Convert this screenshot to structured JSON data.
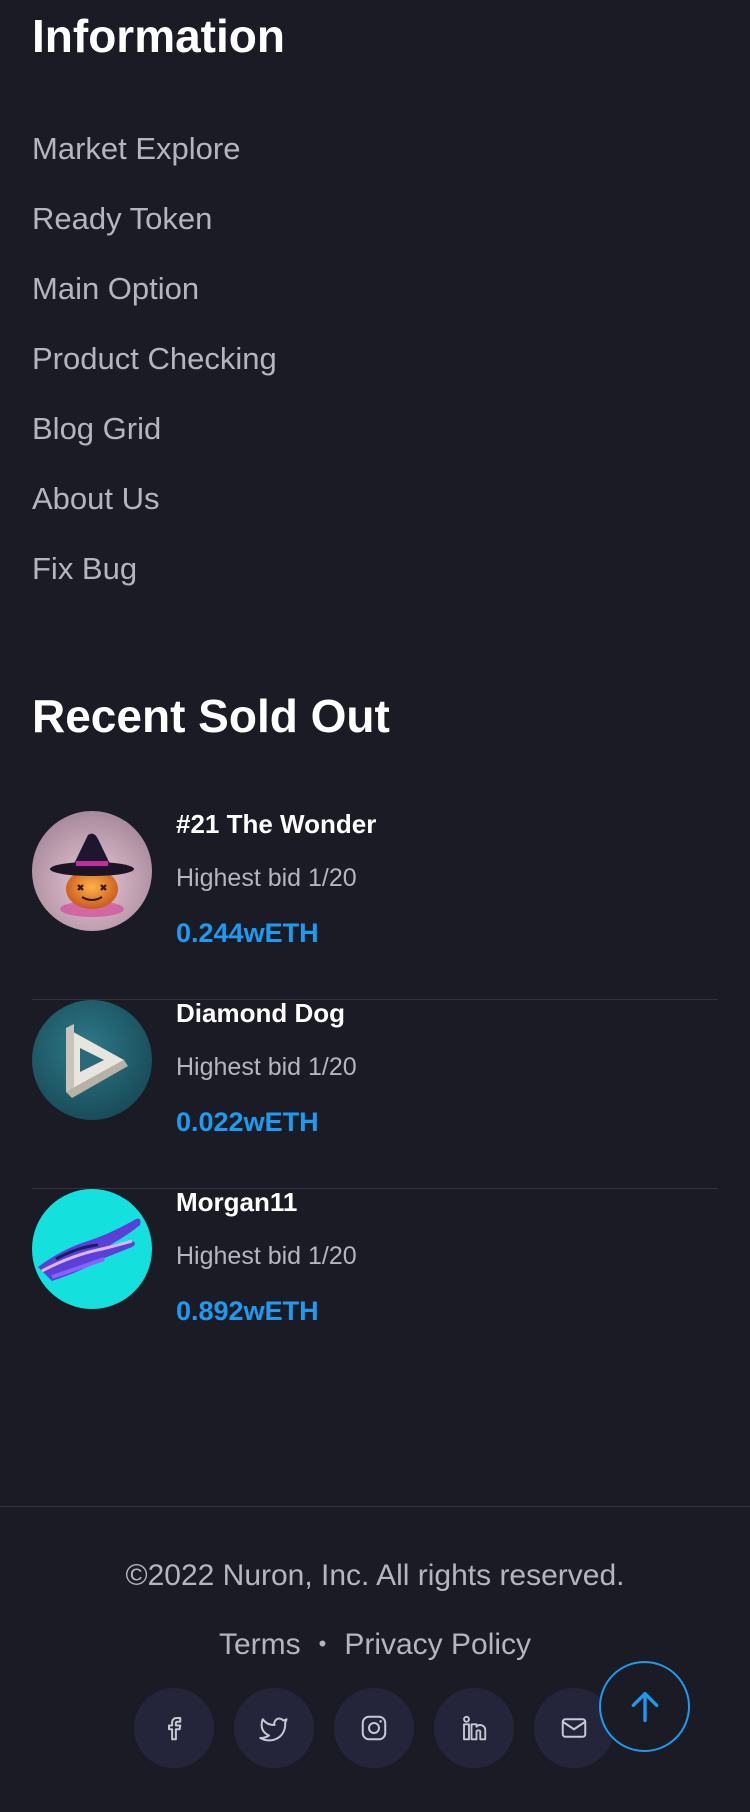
{
  "information": {
    "title": "Information",
    "links": [
      "Market Explore",
      "Ready Token",
      "Main Option",
      "Product Checking",
      "Blog Grid",
      "About Us",
      "Fix Bug"
    ]
  },
  "recent_sold": {
    "title": "Recent Sold Out",
    "items": [
      {
        "name": "#21 The Wonder",
        "bid": "Highest bid 1/20",
        "price": "0.244wETH",
        "image": "pumpkin-witch-hat"
      },
      {
        "name": "Diamond Dog",
        "bid": "Highest bid 1/20",
        "price": "0.022wETH",
        "image": "impossible-triangle"
      },
      {
        "name": "Morgan11",
        "bid": "Highest bid 1/20",
        "price": "0.892wETH",
        "image": "holographic-hand"
      }
    ]
  },
  "footer": {
    "copyright": "©2022 Nuron, Inc. All rights reserved.",
    "terms": "Terms",
    "separator": "•",
    "privacy": "Privacy Policy",
    "social_icons": [
      "facebook-icon",
      "twitter-icon",
      "instagram-icon",
      "linkedin-icon",
      "mail-icon"
    ]
  },
  "colors": {
    "background": "#1b1b26",
    "accent": "#1d9bf0",
    "muted_text": "#b5b5c0"
  }
}
